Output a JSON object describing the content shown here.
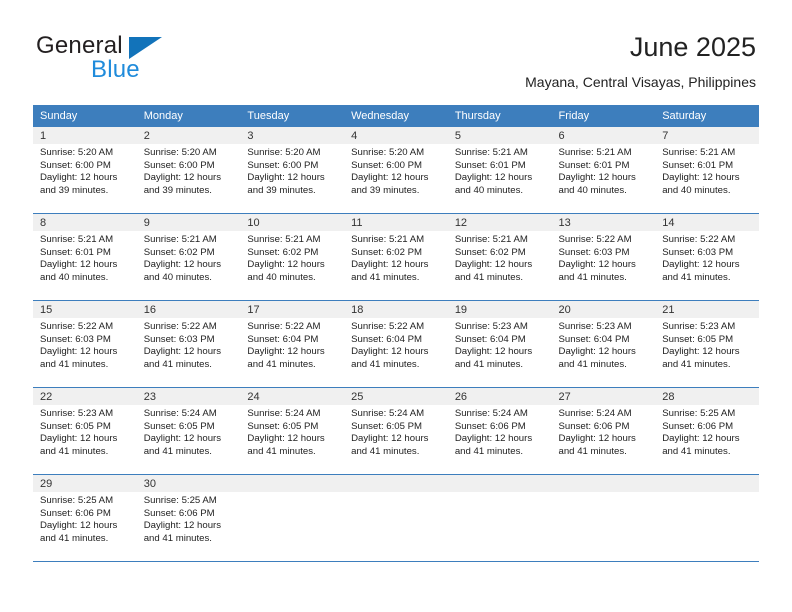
{
  "brand": {
    "name_primary": "General",
    "name_secondary": "Blue",
    "triangle_color": "#1273ba",
    "blue_color": "#1f8bdb"
  },
  "header": {
    "title": "June 2025",
    "subtitle": "Mayana, Central Visayas, Philippines"
  },
  "theme": {
    "header_blue": "#3d7ebd",
    "daynum_band": "#f0f0f0"
  },
  "calendar": {
    "weekday_headers": [
      "Sunday",
      "Monday",
      "Tuesday",
      "Wednesday",
      "Thursday",
      "Friday",
      "Saturday"
    ],
    "weeks": [
      [
        {
          "day": "1",
          "sunrise": "Sunrise: 5:20 AM",
          "sunset": "Sunset: 6:00 PM",
          "daylight_line1": "Daylight: 12 hours",
          "daylight_line2": "and 39 minutes."
        },
        {
          "day": "2",
          "sunrise": "Sunrise: 5:20 AM",
          "sunset": "Sunset: 6:00 PM",
          "daylight_line1": "Daylight: 12 hours",
          "daylight_line2": "and 39 minutes."
        },
        {
          "day": "3",
          "sunrise": "Sunrise: 5:20 AM",
          "sunset": "Sunset: 6:00 PM",
          "daylight_line1": "Daylight: 12 hours",
          "daylight_line2": "and 39 minutes."
        },
        {
          "day": "4",
          "sunrise": "Sunrise: 5:20 AM",
          "sunset": "Sunset: 6:00 PM",
          "daylight_line1": "Daylight: 12 hours",
          "daylight_line2": "and 39 minutes."
        },
        {
          "day": "5",
          "sunrise": "Sunrise: 5:21 AM",
          "sunset": "Sunset: 6:01 PM",
          "daylight_line1": "Daylight: 12 hours",
          "daylight_line2": "and 40 minutes."
        },
        {
          "day": "6",
          "sunrise": "Sunrise: 5:21 AM",
          "sunset": "Sunset: 6:01 PM",
          "daylight_line1": "Daylight: 12 hours",
          "daylight_line2": "and 40 minutes."
        },
        {
          "day": "7",
          "sunrise": "Sunrise: 5:21 AM",
          "sunset": "Sunset: 6:01 PM",
          "daylight_line1": "Daylight: 12 hours",
          "daylight_line2": "and 40 minutes."
        }
      ],
      [
        {
          "day": "8",
          "sunrise": "Sunrise: 5:21 AM",
          "sunset": "Sunset: 6:01 PM",
          "daylight_line1": "Daylight: 12 hours",
          "daylight_line2": "and 40 minutes."
        },
        {
          "day": "9",
          "sunrise": "Sunrise: 5:21 AM",
          "sunset": "Sunset: 6:02 PM",
          "daylight_line1": "Daylight: 12 hours",
          "daylight_line2": "and 40 minutes."
        },
        {
          "day": "10",
          "sunrise": "Sunrise: 5:21 AM",
          "sunset": "Sunset: 6:02 PM",
          "daylight_line1": "Daylight: 12 hours",
          "daylight_line2": "and 40 minutes."
        },
        {
          "day": "11",
          "sunrise": "Sunrise: 5:21 AM",
          "sunset": "Sunset: 6:02 PM",
          "daylight_line1": "Daylight: 12 hours",
          "daylight_line2": "and 41 minutes."
        },
        {
          "day": "12",
          "sunrise": "Sunrise: 5:21 AM",
          "sunset": "Sunset: 6:02 PM",
          "daylight_line1": "Daylight: 12 hours",
          "daylight_line2": "and 41 minutes."
        },
        {
          "day": "13",
          "sunrise": "Sunrise: 5:22 AM",
          "sunset": "Sunset: 6:03 PM",
          "daylight_line1": "Daylight: 12 hours",
          "daylight_line2": "and 41 minutes."
        },
        {
          "day": "14",
          "sunrise": "Sunrise: 5:22 AM",
          "sunset": "Sunset: 6:03 PM",
          "daylight_line1": "Daylight: 12 hours",
          "daylight_line2": "and 41 minutes."
        }
      ],
      [
        {
          "day": "15",
          "sunrise": "Sunrise: 5:22 AM",
          "sunset": "Sunset: 6:03 PM",
          "daylight_line1": "Daylight: 12 hours",
          "daylight_line2": "and 41 minutes."
        },
        {
          "day": "16",
          "sunrise": "Sunrise: 5:22 AM",
          "sunset": "Sunset: 6:03 PM",
          "daylight_line1": "Daylight: 12 hours",
          "daylight_line2": "and 41 minutes."
        },
        {
          "day": "17",
          "sunrise": "Sunrise: 5:22 AM",
          "sunset": "Sunset: 6:04 PM",
          "daylight_line1": "Daylight: 12 hours",
          "daylight_line2": "and 41 minutes."
        },
        {
          "day": "18",
          "sunrise": "Sunrise: 5:22 AM",
          "sunset": "Sunset: 6:04 PM",
          "daylight_line1": "Daylight: 12 hours",
          "daylight_line2": "and 41 minutes."
        },
        {
          "day": "19",
          "sunrise": "Sunrise: 5:23 AM",
          "sunset": "Sunset: 6:04 PM",
          "daylight_line1": "Daylight: 12 hours",
          "daylight_line2": "and 41 minutes."
        },
        {
          "day": "20",
          "sunrise": "Sunrise: 5:23 AM",
          "sunset": "Sunset: 6:04 PM",
          "daylight_line1": "Daylight: 12 hours",
          "daylight_line2": "and 41 minutes."
        },
        {
          "day": "21",
          "sunrise": "Sunrise: 5:23 AM",
          "sunset": "Sunset: 6:05 PM",
          "daylight_line1": "Daylight: 12 hours",
          "daylight_line2": "and 41 minutes."
        }
      ],
      [
        {
          "day": "22",
          "sunrise": "Sunrise: 5:23 AM",
          "sunset": "Sunset: 6:05 PM",
          "daylight_line1": "Daylight: 12 hours",
          "daylight_line2": "and 41 minutes."
        },
        {
          "day": "23",
          "sunrise": "Sunrise: 5:24 AM",
          "sunset": "Sunset: 6:05 PM",
          "daylight_line1": "Daylight: 12 hours",
          "daylight_line2": "and 41 minutes."
        },
        {
          "day": "24",
          "sunrise": "Sunrise: 5:24 AM",
          "sunset": "Sunset: 6:05 PM",
          "daylight_line1": "Daylight: 12 hours",
          "daylight_line2": "and 41 minutes."
        },
        {
          "day": "25",
          "sunrise": "Sunrise: 5:24 AM",
          "sunset": "Sunset: 6:05 PM",
          "daylight_line1": "Daylight: 12 hours",
          "daylight_line2": "and 41 minutes."
        },
        {
          "day": "26",
          "sunrise": "Sunrise: 5:24 AM",
          "sunset": "Sunset: 6:06 PM",
          "daylight_line1": "Daylight: 12 hours",
          "daylight_line2": "and 41 minutes."
        },
        {
          "day": "27",
          "sunrise": "Sunrise: 5:24 AM",
          "sunset": "Sunset: 6:06 PM",
          "daylight_line1": "Daylight: 12 hours",
          "daylight_line2": "and 41 minutes."
        },
        {
          "day": "28",
          "sunrise": "Sunrise: 5:25 AM",
          "sunset": "Sunset: 6:06 PM",
          "daylight_line1": "Daylight: 12 hours",
          "daylight_line2": "and 41 minutes."
        }
      ],
      [
        {
          "day": "29",
          "sunrise": "Sunrise: 5:25 AM",
          "sunset": "Sunset: 6:06 PM",
          "daylight_line1": "Daylight: 12 hours",
          "daylight_line2": "and 41 minutes."
        },
        {
          "day": "30",
          "sunrise": "Sunrise: 5:25 AM",
          "sunset": "Sunset: 6:06 PM",
          "daylight_line1": "Daylight: 12 hours",
          "daylight_line2": "and 41 minutes."
        },
        {
          "day": "",
          "sunrise": "",
          "sunset": "",
          "daylight_line1": "",
          "daylight_line2": ""
        },
        {
          "day": "",
          "sunrise": "",
          "sunset": "",
          "daylight_line1": "",
          "daylight_line2": ""
        },
        {
          "day": "",
          "sunrise": "",
          "sunset": "",
          "daylight_line1": "",
          "daylight_line2": ""
        },
        {
          "day": "",
          "sunrise": "",
          "sunset": "",
          "daylight_line1": "",
          "daylight_line2": ""
        },
        {
          "day": "",
          "sunrise": "",
          "sunset": "",
          "daylight_line1": "",
          "daylight_line2": ""
        }
      ]
    ]
  }
}
